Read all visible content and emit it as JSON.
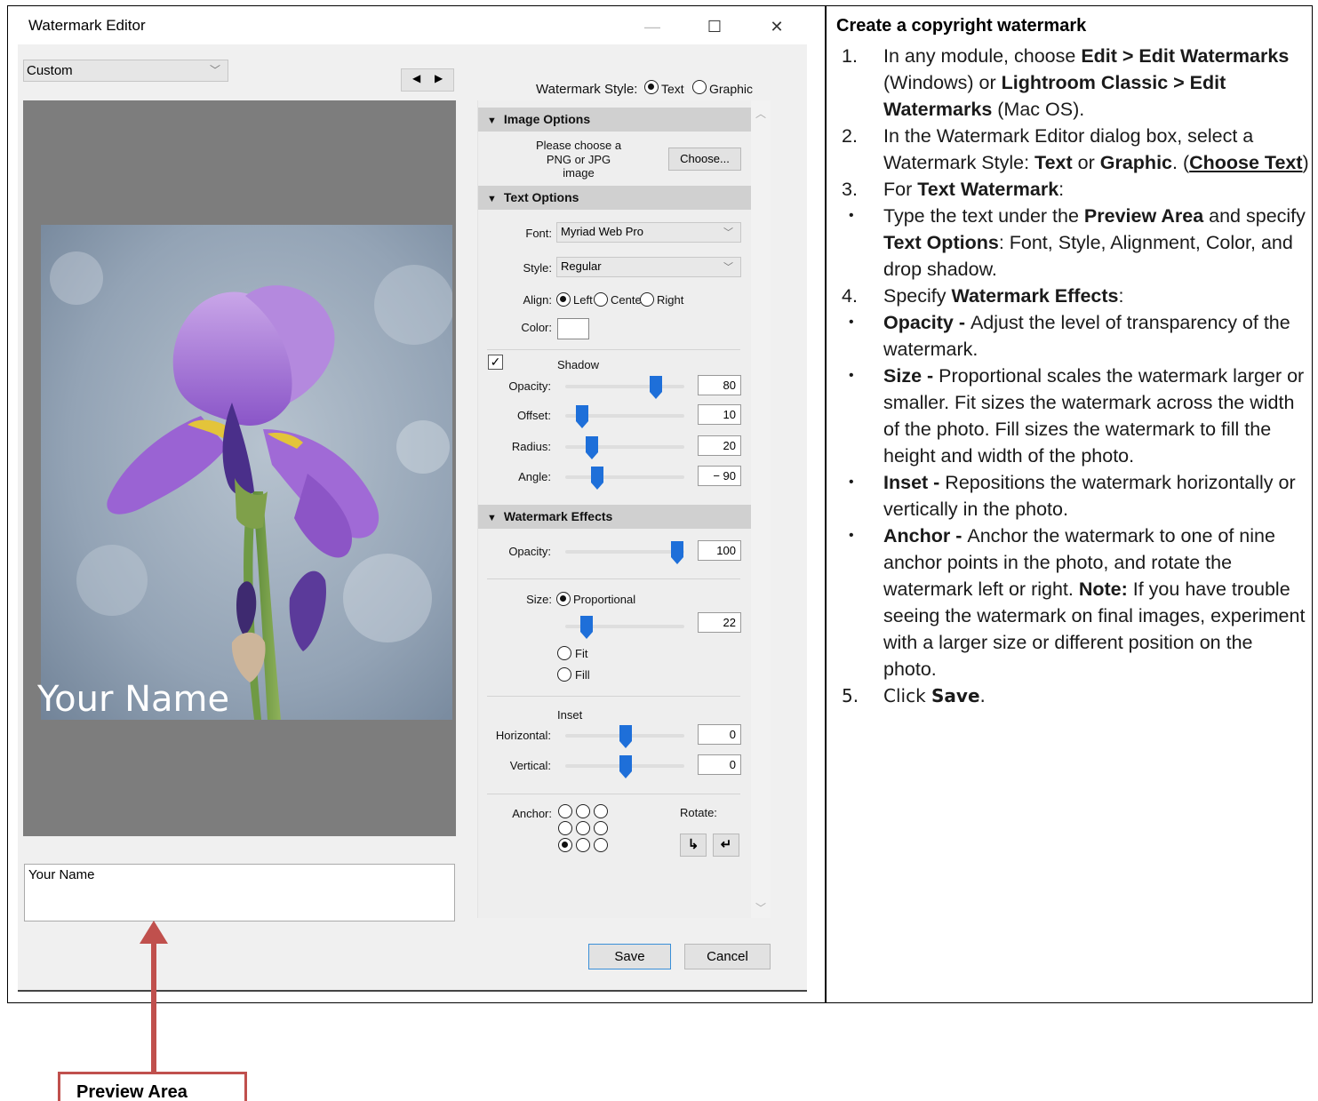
{
  "dialog": {
    "title": "Watermark Editor",
    "preset": "Custom",
    "preview_text": "Your Name",
    "text_field_value": "Your Name",
    "watermark_style": {
      "label": "Watermark Style:",
      "options": [
        "Text",
        "Graphic"
      ],
      "selected": "Text"
    },
    "image_options": {
      "header": "Image Options",
      "hint_line1": "Please choose a",
      "hint_line2": "PNG or JPG image",
      "choose_button": "Choose..."
    },
    "text_options": {
      "header": "Text Options",
      "font_label": "Font:",
      "font_value": "Myriad Web Pro",
      "style_label": "Style:",
      "style_value": "Regular",
      "align_label": "Align:",
      "align_options": [
        "Left",
        "Center",
        "Right"
      ],
      "align_selected": "Left",
      "color_label": "Color:",
      "shadow_label": "Shadow",
      "shadow_checked": true,
      "opacity_label": "Opacity:",
      "opacity_value": "80",
      "offset_label": "Offset:",
      "offset_value": "10",
      "radius_label": "Radius:",
      "radius_value": "20",
      "angle_label": "Angle:",
      "angle_value": "− 90"
    },
    "watermark_effects": {
      "header": "Watermark Effects",
      "opacity_label": "Opacity:",
      "opacity_value": "100",
      "size_label": "Size:",
      "size_options": [
        "Proportional",
        "Fit",
        "Fill"
      ],
      "size_selected": "Proportional",
      "size_value": "22",
      "inset_label": "Inset",
      "horizontal_label": "Horizontal:",
      "horizontal_value": "0",
      "vertical_label": "Vertical:",
      "vertical_value": "0",
      "anchor_label": "Anchor:",
      "anchor_selected": "bottom-left",
      "rotate_label": "Rotate:"
    },
    "save_button": "Save",
    "cancel_button": "Cancel"
  },
  "instructions": {
    "title": "Create a copyright watermark",
    "steps": [
      {
        "marker": "1.",
        "parts": [
          [
            "In any module, choose ",
            false
          ],
          [
            "Edit > Edit Watermarks",
            true
          ],
          [
            " (Windows) or ",
            false
          ],
          [
            "Lightroom Classic > Edit Watermarks",
            true
          ],
          [
            " (Mac OS).",
            false
          ]
        ]
      },
      {
        "marker": "2.",
        "parts": [
          [
            "In the Watermark Editor dialog box, select a Watermark Style: ",
            false
          ],
          [
            "Text",
            true
          ],
          [
            " or ",
            false
          ],
          [
            "Graphic",
            true
          ],
          [
            ". (",
            false
          ],
          [
            "Choose Text",
            "u"
          ],
          [
            ")",
            false
          ]
        ]
      },
      {
        "marker": "3.",
        "parts": [
          [
            "For ",
            false
          ],
          [
            "Text Watermark",
            true
          ],
          [
            ":",
            false
          ]
        ]
      },
      {
        "marker": "•",
        "parts": [
          [
            "Type the text under the ",
            false
          ],
          [
            "Preview Area",
            true
          ],
          [
            " and specify ",
            false
          ],
          [
            "Text Options",
            true
          ],
          [
            ": Font, Style, Alignment, Color, and drop shadow.",
            false
          ]
        ]
      },
      {
        "marker": "4.",
        "parts": [
          [
            "Specify ",
            false
          ],
          [
            "Watermark Effects",
            true
          ],
          [
            ":",
            false
          ]
        ]
      },
      {
        "marker": "•",
        "parts": [
          [
            "Opacity - ",
            true
          ],
          [
            "Adjust the level of transparency of the watermark.",
            false
          ]
        ]
      },
      {
        "marker": "•",
        "parts": [
          [
            "Size - ",
            true
          ],
          [
            "Proportional scales the watermark larger or smaller. Fit sizes the watermark across the width of the photo. Fill sizes the watermark to fill the height and width of the photo.",
            false
          ]
        ]
      },
      {
        "marker": "•",
        "parts": [
          [
            "Inset - ",
            true
          ],
          [
            "Repositions the watermark horizontally or vertically in the photo.",
            false
          ]
        ]
      },
      {
        "marker": "•",
        "parts": [
          [
            "Anchor - ",
            true
          ],
          [
            "Anchor the watermark to one of nine anchor points in the photo, and rotate the watermark left or right. ",
            false
          ],
          [
            "Note:",
            true
          ],
          [
            " If you have trouble seeing the watermark on final images, experiment with a larger size or different position on the photo.",
            false
          ]
        ]
      },
      {
        "marker": "5.",
        "parts": [
          [
            "Click ",
            false
          ],
          [
            "Save",
            true
          ],
          [
            ".",
            false
          ]
        ]
      }
    ]
  },
  "callout": {
    "label": "Preview Area"
  }
}
